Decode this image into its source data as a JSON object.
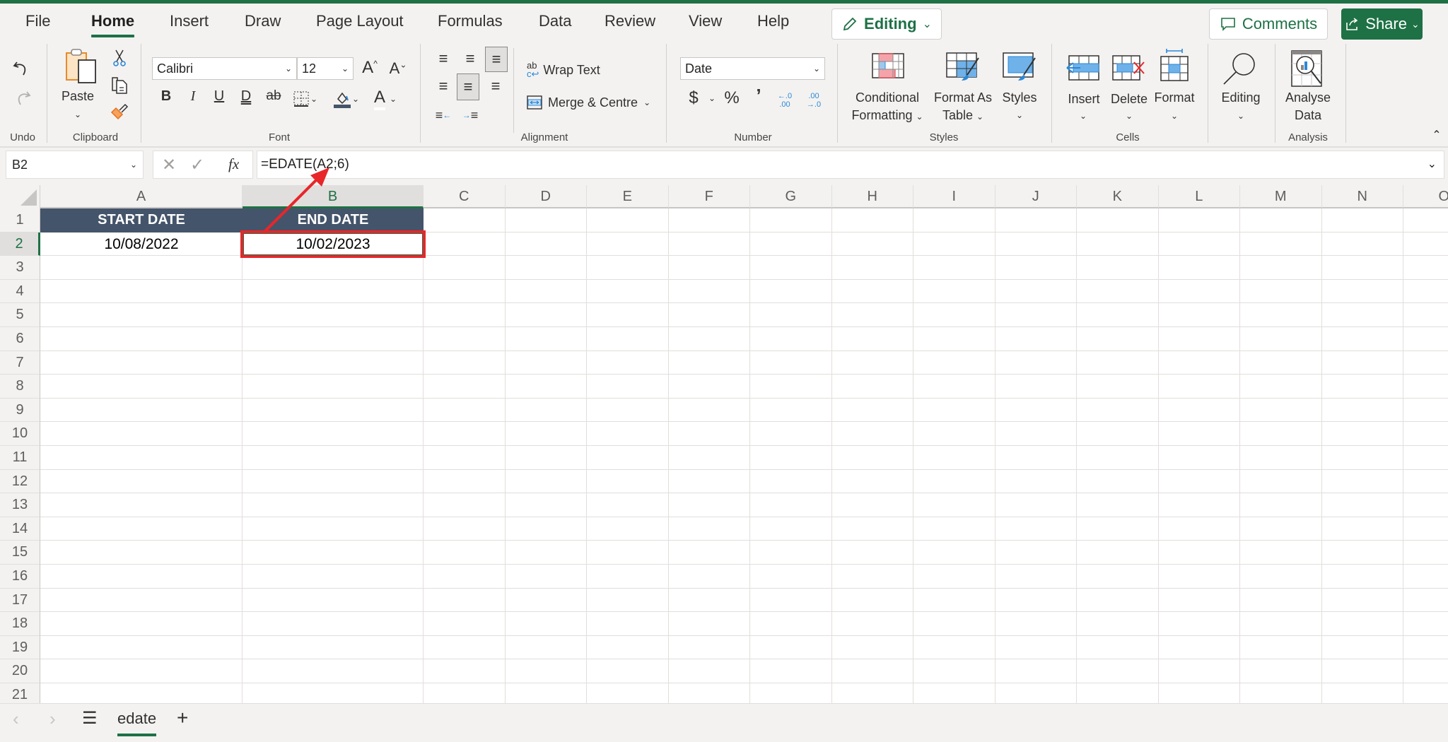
{
  "ribbon_tabs": [
    {
      "label": "File",
      "active": false
    },
    {
      "label": "Home",
      "active": true
    },
    {
      "label": "Insert",
      "active": false
    },
    {
      "label": "Draw",
      "active": false
    },
    {
      "label": "Page Layout",
      "active": false
    },
    {
      "label": "Formulas",
      "active": false
    },
    {
      "label": "Data",
      "active": false
    },
    {
      "label": "Review",
      "active": false
    },
    {
      "label": "View",
      "active": false
    },
    {
      "label": "Help",
      "active": false
    }
  ],
  "mode_button": {
    "label": "Editing",
    "icon": "pencil-icon"
  },
  "comments_button": {
    "label": "Comments",
    "icon": "comment-icon"
  },
  "share_button": {
    "label": "Share",
    "icon": "share-icon"
  },
  "groups": {
    "undo": {
      "label": "Undo"
    },
    "clipboard": {
      "label": "Clipboard",
      "paste_label": "Paste"
    },
    "font": {
      "label": "Font",
      "font_name": "Calibri",
      "font_size": "12",
      "bold": "B",
      "italic": "I",
      "underline": "U",
      "double_underline": "D",
      "strikethrough": "ab",
      "font_color": "A"
    },
    "alignment": {
      "label": "Alignment",
      "wrap_text": "Wrap Text",
      "merge_centre": "Merge & Centre"
    },
    "number": {
      "label": "Number",
      "format": "Date",
      "currency": "$",
      "percent": "%",
      "comma": "’",
      "increase_decimal": "←.0 .00",
      "decrease_decimal": ".00 →.0"
    },
    "styles": {
      "label": "Styles",
      "conditional_1": "Conditional",
      "conditional_2": "Formatting",
      "format_table_1": "Format As",
      "format_table_2": "Table",
      "cell_styles": "Styles"
    },
    "cells": {
      "label": "Cells",
      "insert": "Insert",
      "delete": "Delete",
      "format": "Format"
    },
    "editing": {
      "label": "Editing"
    },
    "analysis": {
      "label": "Analysis",
      "analyse_1": "Analyse",
      "analyse_2": "Data"
    }
  },
  "formula_bar": {
    "name_box": "B2",
    "fx_label": "fx",
    "formula": "=EDATE(A2;6)"
  },
  "columns": [
    "A",
    "B",
    "C",
    "D",
    "E",
    "F",
    "G",
    "H",
    "I",
    "J",
    "K",
    "L",
    "M",
    "N",
    "O"
  ],
  "rows": [
    "1",
    "2",
    "3",
    "4",
    "5",
    "6",
    "7",
    "8",
    "9",
    "10",
    "11",
    "12",
    "13",
    "14",
    "15",
    "16",
    "17",
    "18",
    "19",
    "20",
    "21"
  ],
  "cells": {
    "A1": "START DATE",
    "B1": "END DATE",
    "A2": "10/08/2022",
    "B2": "10/02/2023"
  },
  "selected_cell": "B2",
  "colors": {
    "brand_green": "#1e7145",
    "header_fill": "#44546a",
    "annotation_red": "#e8262a"
  },
  "sheets": [
    {
      "name": "edate",
      "active": true
    }
  ]
}
